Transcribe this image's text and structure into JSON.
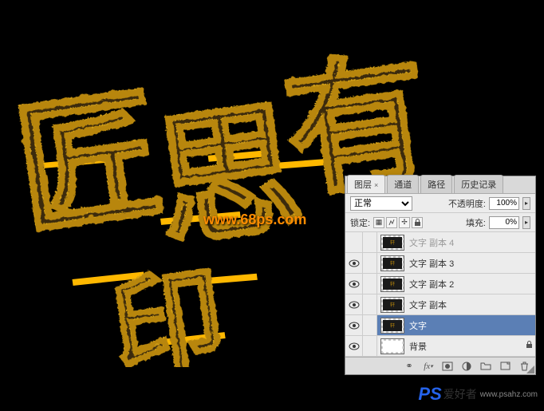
{
  "watermarks": {
    "center": "www.68ps.com",
    "corner_ps": "PS",
    "corner_cn": "爱好者",
    "corner_url": "www.psahz.com"
  },
  "panel": {
    "tabs": {
      "layers": "图层",
      "channels": "通道",
      "paths": "路径",
      "history": "历史记录"
    },
    "blend_mode_label": "正常",
    "opacity_label": "不透明度:",
    "opacity_value": "100%",
    "lock_label": "锁定:",
    "fill_label": "填充:",
    "fill_value": "0%",
    "layers": [
      {
        "name": "文字 副本 4",
        "visible": false,
        "selected": false,
        "type": "text"
      },
      {
        "name": "文字 副本 3",
        "visible": true,
        "selected": false,
        "type": "text"
      },
      {
        "name": "文字 副本 2",
        "visible": true,
        "selected": false,
        "type": "text"
      },
      {
        "name": "文字 副本",
        "visible": true,
        "selected": false,
        "type": "text"
      },
      {
        "name": "文字",
        "visible": true,
        "selected": true,
        "type": "text"
      },
      {
        "name": "背景",
        "visible": true,
        "selected": false,
        "type": "bg"
      }
    ],
    "footer_icons": {
      "link": "link",
      "fx": "fx",
      "mask": "mask",
      "adjust": "adjust",
      "group": "group",
      "new": "new",
      "trash": "trash"
    }
  }
}
